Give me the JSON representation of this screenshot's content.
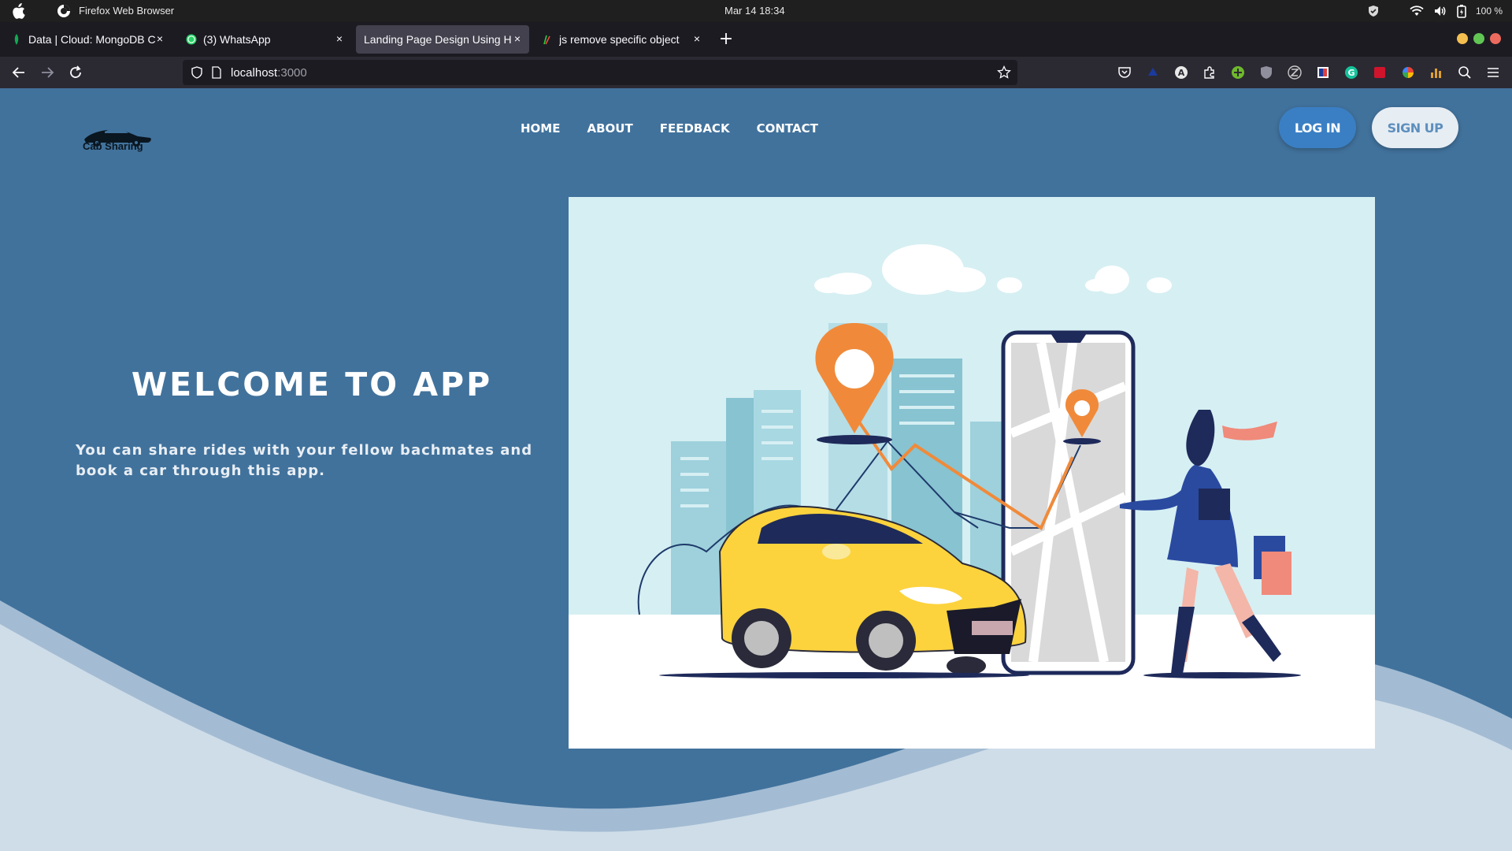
{
  "os": {
    "app_name": "Firefox Web Browser",
    "clock": "Mar 14  18:34",
    "battery": "100 %"
  },
  "browser": {
    "tabs": [
      {
        "title": "Data | Cloud: MongoDB C",
        "favicon": "mongodb-leaf-icon"
      },
      {
        "title": "(3) WhatsApp",
        "favicon": "whatsapp-icon"
      },
      {
        "title": "Landing Page Design Using H",
        "favicon": "none"
      },
      {
        "title": "js remove specific object",
        "favicon": "stackoverflow-icon"
      }
    ],
    "active_tab": 2,
    "url_host": "localhost",
    "url_port": ":3000"
  },
  "site": {
    "logo_text": "Cab Sharing",
    "nav": [
      "HOME",
      "ABOUT",
      "FEEDBACK",
      "CONTACT"
    ],
    "login_label": "LOG IN",
    "signup_label": "SIGN UP",
    "hero_title": "WELCOME TO APP",
    "hero_subtitle": "You can share rides with your fellow bachmates and book a car through this app.",
    "colors": {
      "page_bg": "#41729c",
      "wave_light": "#cfdde8",
      "wave_mid": "#a3bcd3",
      "login_bg": "#3a7fc4",
      "signup_bg": "#e6edf3"
    }
  }
}
